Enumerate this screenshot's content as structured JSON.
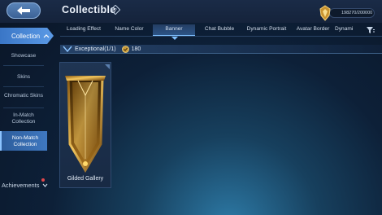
{
  "header": {
    "title": "Collectible",
    "currency_value": "198270/200000"
  },
  "sidebar": {
    "items": [
      {
        "label": "Collection"
      },
      {
        "label": "Showcase"
      },
      {
        "label": "Skins"
      },
      {
        "label": "Chromatic Skins"
      },
      {
        "label": "In-Match Collection"
      },
      {
        "label": "Non-Match Collection"
      },
      {
        "label": "Achievements"
      }
    ]
  },
  "tabs": [
    {
      "label": "Loading Effect"
    },
    {
      "label": "Name Color"
    },
    {
      "label": "Banner"
    },
    {
      "label": "Chat Bubble"
    },
    {
      "label": "Dynamic Portrait"
    },
    {
      "label": "Avatar Border"
    },
    {
      "label": "Dynami"
    }
  ],
  "section": {
    "label": "Exceptional(1/1)",
    "points": "180"
  },
  "items": [
    {
      "label": "Gilded Gallery"
    }
  ],
  "colors": {
    "accent": "#4a8fe0",
    "gold": "#e0b04a"
  }
}
